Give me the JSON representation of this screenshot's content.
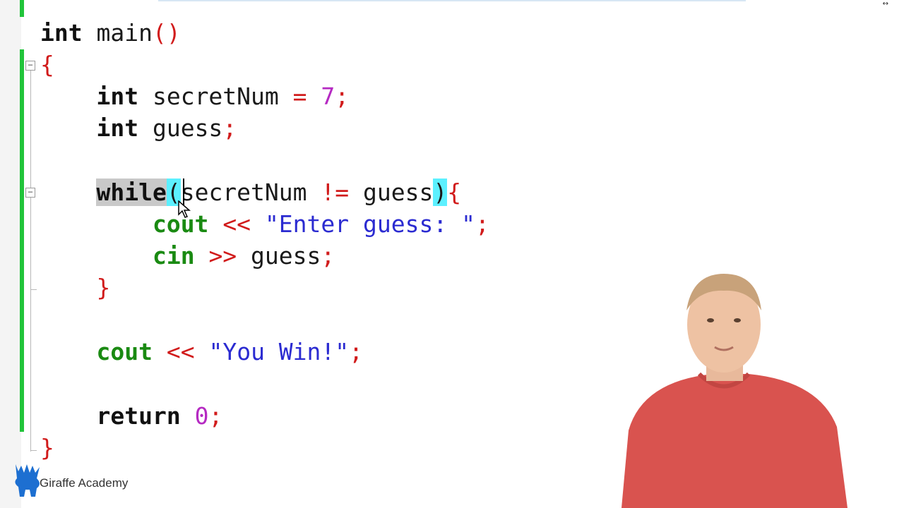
{
  "editor": {
    "lines": [
      {
        "id": "l1",
        "tokens": [
          {
            "text": "int",
            "cls": "kw-black"
          },
          {
            "text": " main",
            "cls": "plain"
          },
          {
            "text": "()",
            "cls": "op"
          }
        ]
      },
      {
        "id": "l2",
        "tokens": [
          {
            "text": "{",
            "cls": "op"
          }
        ]
      },
      {
        "id": "l3",
        "tokens": [
          {
            "text": "    ",
            "cls": "plain"
          },
          {
            "text": "int",
            "cls": "kw-black"
          },
          {
            "text": " secretNum ",
            "cls": "plain"
          },
          {
            "text": "=",
            "cls": "op"
          },
          {
            "text": " ",
            "cls": "plain"
          },
          {
            "text": "7",
            "cls": "num"
          },
          {
            "text": ";",
            "cls": "op"
          }
        ]
      },
      {
        "id": "l4",
        "tokens": [
          {
            "text": "    ",
            "cls": "plain"
          },
          {
            "text": "int",
            "cls": "kw-black"
          },
          {
            "text": " guess",
            "cls": "plain"
          },
          {
            "text": ";",
            "cls": "op"
          }
        ]
      },
      {
        "id": "l5",
        "tokens": [
          {
            "text": "    ",
            "cls": "plain"
          },
          {
            "text": "while",
            "cls": "kw-black sel-word"
          },
          {
            "text": "(",
            "cls": "plain paren-hl"
          },
          {
            "text": "secretNum ",
            "cls": "plain"
          },
          {
            "text": "!=",
            "cls": "op"
          },
          {
            "text": " guess",
            "cls": "plain"
          },
          {
            "text": ")",
            "cls": "plain paren-hl"
          },
          {
            "text": "{",
            "cls": "op"
          }
        ]
      },
      {
        "id": "l6",
        "tokens": [
          {
            "text": "        ",
            "cls": "plain"
          },
          {
            "text": "cout",
            "cls": "io"
          },
          {
            "text": " ",
            "cls": "plain"
          },
          {
            "text": "<<",
            "cls": "op"
          },
          {
            "text": " ",
            "cls": "plain"
          },
          {
            "text": "\"Enter guess: \"",
            "cls": "str"
          },
          {
            "text": ";",
            "cls": "op"
          }
        ]
      },
      {
        "id": "l7",
        "tokens": [
          {
            "text": "        ",
            "cls": "plain"
          },
          {
            "text": "cin",
            "cls": "io"
          },
          {
            "text": " ",
            "cls": "plain"
          },
          {
            "text": ">>",
            "cls": "op"
          },
          {
            "text": " guess",
            "cls": "plain"
          },
          {
            "text": ";",
            "cls": "op"
          }
        ]
      },
      {
        "id": "l8",
        "tokens": [
          {
            "text": "    ",
            "cls": "plain"
          },
          {
            "text": "}",
            "cls": "op"
          }
        ]
      },
      {
        "id": "l9",
        "tokens": [
          {
            "text": "    ",
            "cls": "plain"
          },
          {
            "text": "cout",
            "cls": "io"
          },
          {
            "text": " ",
            "cls": "plain"
          },
          {
            "text": "<<",
            "cls": "op"
          },
          {
            "text": " ",
            "cls": "plain"
          },
          {
            "text": "\"You Win!\"",
            "cls": "str"
          },
          {
            "text": ";",
            "cls": "op"
          }
        ]
      },
      {
        "id": "l10",
        "tokens": [
          {
            "text": "    ",
            "cls": "plain"
          },
          {
            "text": "return",
            "cls": "kw-black"
          },
          {
            "text": " ",
            "cls": "plain"
          },
          {
            "text": "0",
            "cls": "num"
          },
          {
            "text": ";",
            "cls": "op"
          }
        ]
      },
      {
        "id": "l11",
        "tokens": [
          {
            "text": "}",
            "cls": "op"
          }
        ]
      }
    ]
  },
  "branding": {
    "logo_text": "Giraffe Academy",
    "logo_icon": "giraffe-icon"
  },
  "colors": {
    "keyword": "#111111",
    "io_keyword": "#1a8a12",
    "string": "#2b2bd1",
    "number": "#b52ac2",
    "operator": "#d11b1b",
    "change_bar": "#21c43a",
    "paren_match": "#5cf0ff",
    "selection": "#c9c9c9"
  }
}
